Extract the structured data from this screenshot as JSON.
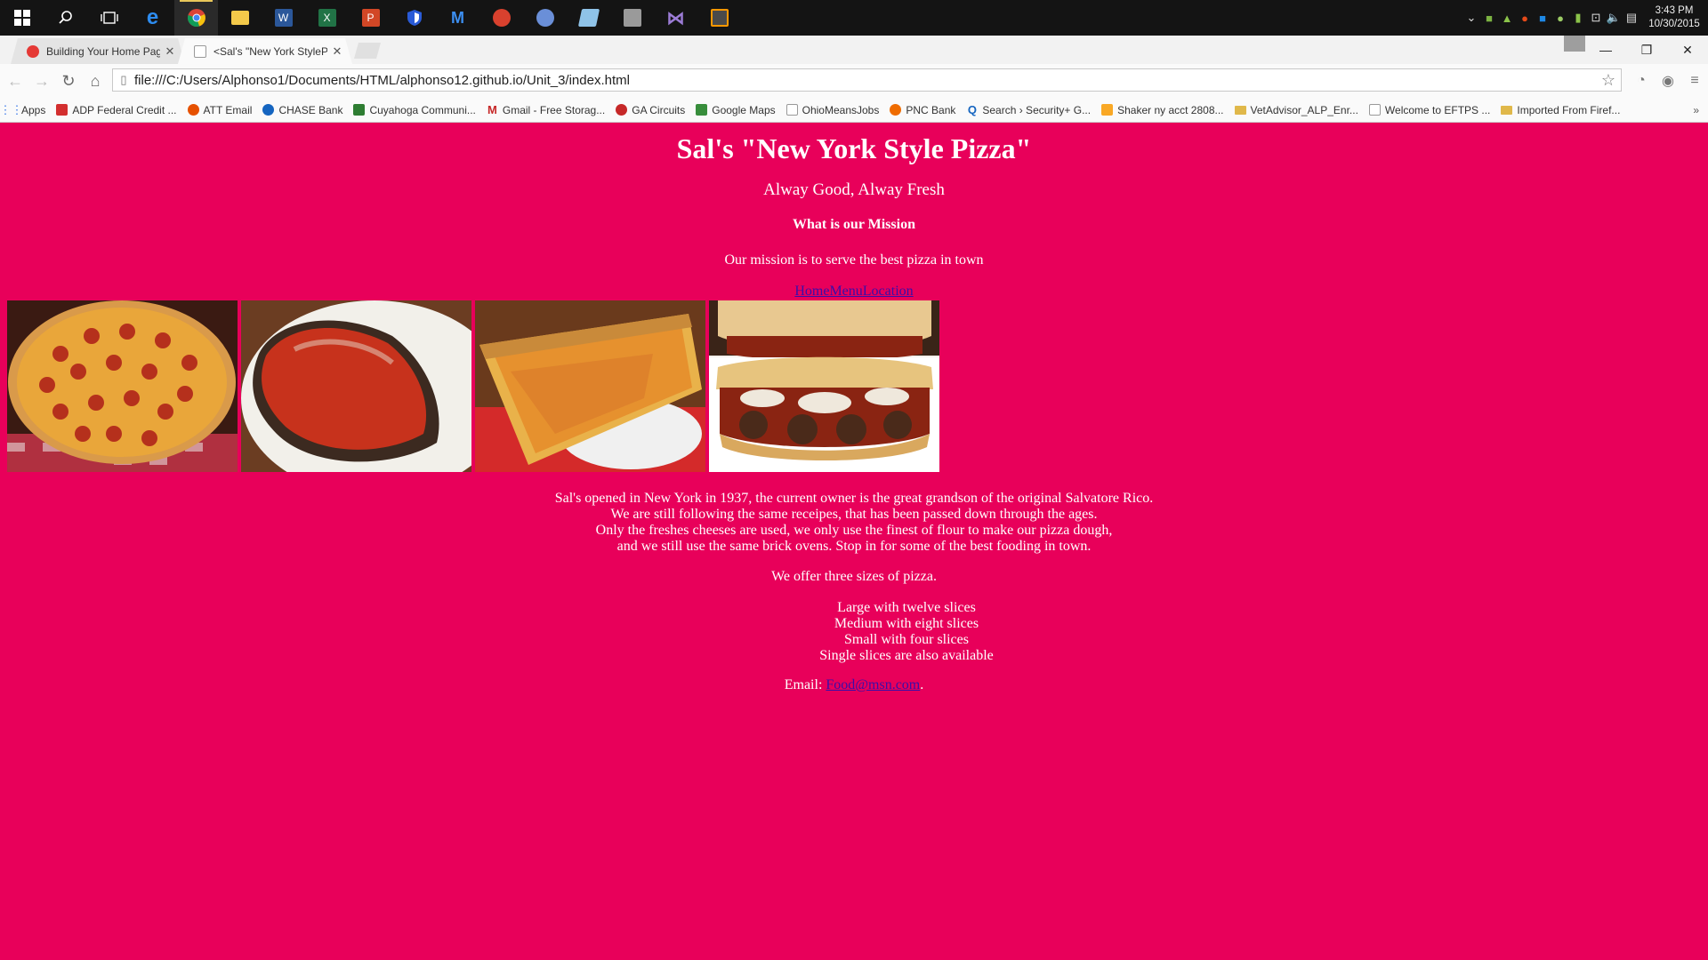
{
  "taskbar": {
    "clock_time": "3:43 PM",
    "clock_date": "10/30/2015"
  },
  "tabs": [
    {
      "label": "Building Your Home Page",
      "active": false
    },
    {
      "label": "<Sal's \"New York StylePiz",
      "active": true
    }
  ],
  "omnibox": {
    "url": "file:///C:/Users/Alphonso1/Documents/HTML/alphonso12.github.io/Unit_3/index.html"
  },
  "bookmarks": [
    {
      "label": "Apps",
      "icon": "apps-grid-icon",
      "color": "#3b78e7"
    },
    {
      "label": "ADP Federal Credit ...",
      "icon": "adp-icon",
      "color": "#d32f2f"
    },
    {
      "label": "ATT  Email",
      "icon": "att-icon",
      "color": "#e65100"
    },
    {
      "label": "CHASE Bank",
      "icon": "chase-icon",
      "color": "#1565c0"
    },
    {
      "label": "Cuyahoga Communi...",
      "icon": "cuyahoga-icon",
      "color": "#2e7d32"
    },
    {
      "label": "Gmail - Free Storag...",
      "icon": "gmail-icon",
      "color": "#c62828"
    },
    {
      "label": "GA Circuits",
      "icon": "ga-circuits-icon",
      "color": "#c62828"
    },
    {
      "label": "Google Maps",
      "icon": "maps-icon",
      "color": "#388e3c"
    },
    {
      "label": "OhioMeansJobs",
      "icon": "page-icon",
      "color": "#9e9e9e"
    },
    {
      "label": "PNC Bank",
      "icon": "pnc-icon",
      "color": "#ef6c00"
    },
    {
      "label": "Search › Security+ G...",
      "icon": "quizlet-icon",
      "color": "#1565c0"
    },
    {
      "label": "Shaker ny acct 2808...",
      "icon": "spreadsheet-icon",
      "color": "#f9a825"
    },
    {
      "label": "VetAdvisor_ALP_Enr...",
      "icon": "folder-icon",
      "color": "#e0b84a"
    },
    {
      "label": "Welcome to EFTPS ...",
      "icon": "page-icon",
      "color": "#9e9e9e"
    },
    {
      "label": "Imported From Firef...",
      "icon": "folder-icon",
      "color": "#e0b84a"
    }
  ],
  "page": {
    "title": "Sal's \"New York Style Pizza\"",
    "tagline": "Alway Good, Alway Fresh",
    "mission_heading": "What is our Mission",
    "mission_text": "Our mission is to serve the best pizza in town",
    "nav": [
      "Home",
      "Menu",
      "Location"
    ],
    "photos": [
      {
        "name": "pepperoni-pizza-photo"
      },
      {
        "name": "calzone-photo"
      },
      {
        "name": "cheese-slice-photo"
      },
      {
        "name": "meatball-sub-photo"
      }
    ],
    "story_lines": [
      "Sal's opened in New York in 1937, the current owner is the great grandson of the original Salvatore Rico.",
      "We are still following the same receipes, that has been passed down through the ages.",
      "Only the freshes cheeses are used, we only use the finest of flour to make our pizza dough,",
      "and we still use the same brick ovens. Stop in for some of the best fooding in town."
    ],
    "offer": "We offer three sizes of pizza.",
    "sizes": [
      "Large with twelve slices",
      "Medium with eight slices",
      "Small with four slices",
      "Single slices are also available"
    ],
    "email_label": "Email: ",
    "email_link": "Food@msn.com",
    "email_suffix": "."
  },
  "colors": {
    "page_background": "#e8005a",
    "link": "#3a0ea8"
  }
}
